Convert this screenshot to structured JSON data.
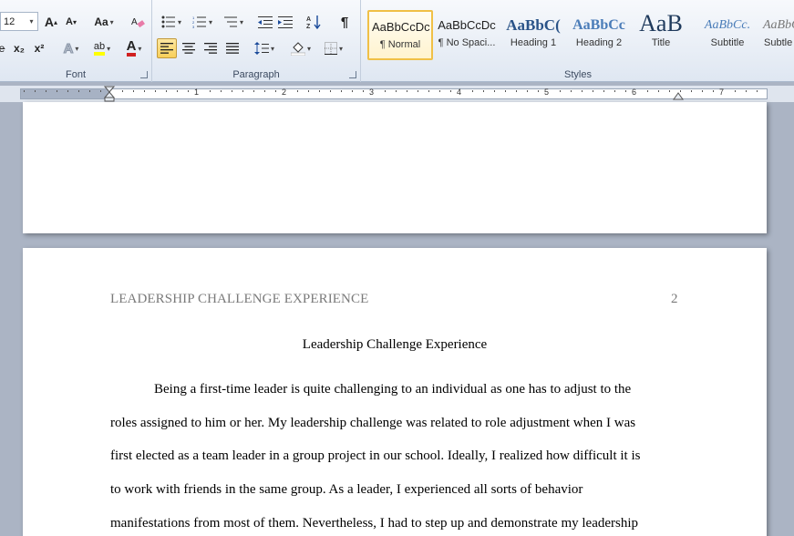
{
  "font_group": {
    "label": "Font",
    "font_size": "12",
    "grow_font": "A",
    "shrink_font": "A",
    "change_case": "Aa",
    "subscript": "x₂",
    "superscript": "x²",
    "text_effects": "A",
    "highlight": "ab",
    "font_color": "A"
  },
  "paragraph_group": {
    "label": "Paragraph",
    "pilcrow": "¶"
  },
  "styles_group": {
    "label": "Styles",
    "items": [
      {
        "sample": "AaBbCcDc",
        "name": "¶ Normal"
      },
      {
        "sample": "AaBbCcDc",
        "name": "¶ No Spaci..."
      },
      {
        "sample": "AaBbC(",
        "name": "Heading 1"
      },
      {
        "sample": "AaBbCc",
        "name": "Heading 2"
      },
      {
        "sample": "AaB",
        "name": "Title"
      },
      {
        "sample": "AaBbCc.",
        "name": "Subtitle"
      },
      {
        "sample": "AaBbCc",
        "name": "Subtle"
      }
    ]
  },
  "ruler": {
    "numbers": [
      "1",
      "2",
      "3",
      "4",
      "5",
      "6",
      "7"
    ]
  },
  "document": {
    "header_title": "LEADERSHIP CHALLENGE EXPERIENCE",
    "page_number": "2",
    "title": "Leadership Challenge Experience",
    "lines": [
      "Being a first-time leader is quite challenging to an individual as one has to adjust to the",
      "roles assigned to him or her. My leadership challenge was related to role adjustment when I was",
      "first elected as a team leader in a group project in our school. Ideally, I realized how difficult it is",
      "to work with friends in the same group. As a leader, I experienced all sorts of behavior",
      "manifestations from most of them. Nevertheless, I had to step up and demonstrate my leadership"
    ]
  },
  "colors": {
    "accent": "#f0c047",
    "font_color_bar": "#d02020",
    "highlight_bar": "#ffff00"
  }
}
